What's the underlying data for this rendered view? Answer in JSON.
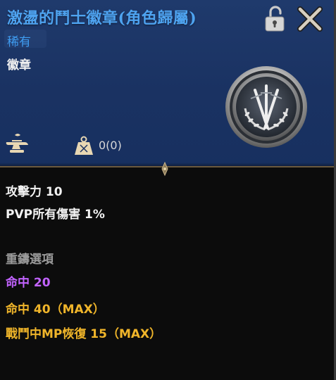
{
  "item": {
    "title": "激盪的鬥士徽章(角色歸屬)",
    "rarity": "稀有",
    "category": "徽章",
    "weight": "0(0)"
  },
  "icons": {
    "lock": "unlock-icon",
    "close": "close-icon",
    "enhance": "anvil-icon",
    "weight": "weight-icon",
    "emblem": "fighter-emblem"
  },
  "stats": {
    "attack": "攻擊力 10",
    "pvp_damage": "PVP所有傷害 1%"
  },
  "reforge": {
    "title": "重鑄選項",
    "options": [
      "命中 20",
      "命中 40（MAX）",
      "戰鬥中MP恢復 15（MAX）"
    ]
  },
  "colors": {
    "header_bg": "#1b3464",
    "title": "#4ea3f0",
    "rarity": "#3f9df2",
    "purple_option": "#c263ff",
    "gold_option": "#f0b52a",
    "section_label": "#9a9a9a"
  }
}
